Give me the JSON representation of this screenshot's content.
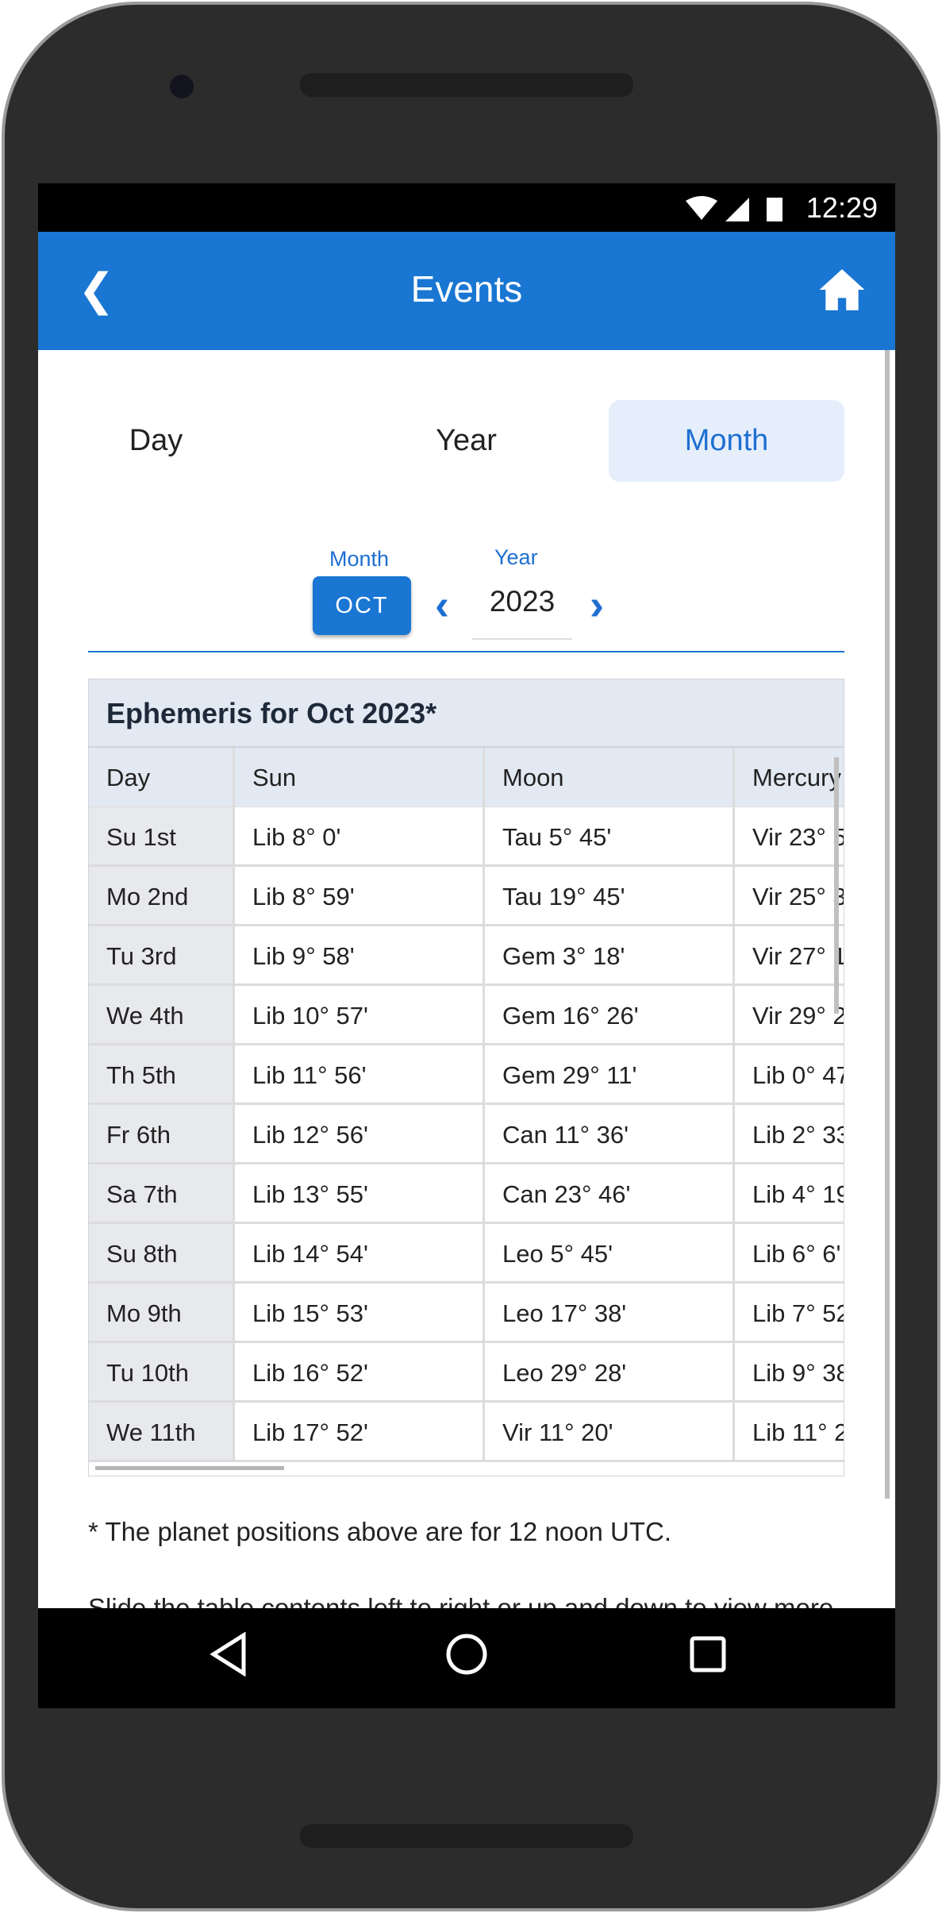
{
  "status": {
    "time": "12:29"
  },
  "appbar": {
    "title": "Events"
  },
  "tabs": [
    {
      "label": "Day"
    },
    {
      "label": "Year"
    },
    {
      "label": "Month",
      "active": true
    }
  ],
  "selector": {
    "month_label": "Month",
    "month_value": "OCT",
    "year_label": "Year",
    "year_value": "2023"
  },
  "table": {
    "title": "Ephemeris for Oct 2023*",
    "headers": [
      "Day",
      "Sun",
      "Moon",
      "Mercury"
    ],
    "rows": [
      [
        "Su 1st",
        "Lib 8° 0'",
        "Tau 5° 45'",
        "Vir 23° 5"
      ],
      [
        "Mo 2nd",
        "Lib 8° 59'",
        "Tau 19° 45'",
        "Vir 25° 3"
      ],
      [
        "Tu 3rd",
        "Lib 9° 58'",
        "Gem 3° 18'",
        "Vir 27° 1"
      ],
      [
        "We 4th",
        "Lib 10° 57'",
        "Gem 16° 26'",
        "Vir 29° 2'"
      ],
      [
        "Th 5th",
        "Lib 11° 56'",
        "Gem 29° 11'",
        "Lib 0° 47"
      ],
      [
        "Fr 6th",
        "Lib 12° 56'",
        "Can 11° 36'",
        "Lib 2° 33"
      ],
      [
        "Sa 7th",
        "Lib 13° 55'",
        "Can 23° 46'",
        "Lib 4° 19"
      ],
      [
        "Su 8th",
        "Lib 14° 54'",
        "Leo 5° 45'",
        "Lib 6° 6'"
      ],
      [
        "Mo 9th",
        "Lib 15° 53'",
        "Leo 17° 38'",
        "Lib 7° 52"
      ],
      [
        "Tu 10th",
        "Lib 16° 52'",
        "Leo 29° 28'",
        "Lib 9° 38"
      ],
      [
        "We 11th",
        "Lib 17° 52'",
        "Vir 11° 20'",
        "Lib 11° 2"
      ]
    ]
  },
  "notes": {
    "footnote": "* The planet positions above are for 12 noon UTC.",
    "hint": "Slide the table contents left to right or up and down to view more"
  },
  "colors": {
    "primary": "#1976d2",
    "active_tab_bg": "#e6eefc"
  }
}
